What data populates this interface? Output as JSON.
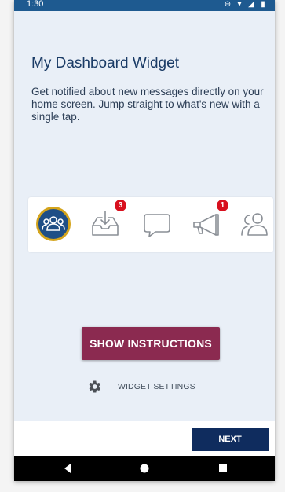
{
  "status_bar": {
    "time": "1:30",
    "icons": [
      "do-not-disturb-icon",
      "wifi-icon",
      "signal-icon",
      "battery-icon"
    ]
  },
  "header": {
    "title": "My Dashboard Widget"
  },
  "description": "Get notified about new messages directly on your home screen. Jump straight to what's new with a single tap.",
  "widget_preview": {
    "icons": [
      {
        "name": "community-icon",
        "badge": null,
        "selected": true
      },
      {
        "name": "inbox-icon",
        "badge": "3",
        "selected": false
      },
      {
        "name": "chat-bubble-icon",
        "badge": null,
        "selected": false
      },
      {
        "name": "megaphone-icon",
        "badge": "1",
        "selected": false
      },
      {
        "name": "contacts-icon",
        "badge": null,
        "selected": false
      }
    ]
  },
  "actions": {
    "show_instructions_label": "SHOW INSTRUCTIONS",
    "widget_settings_label": "WIDGET SETTINGS",
    "next_label": "NEXT"
  },
  "colors": {
    "status_bar": "#1e5a90",
    "background": "#e9eff7",
    "title_text": "#1a3b66",
    "primary_button": "#8b2a50",
    "next_button": "#0f2c5e",
    "badge": "#d8101e",
    "selected_ring": "#d4a41c",
    "selected_fill": "#1f4f86"
  }
}
